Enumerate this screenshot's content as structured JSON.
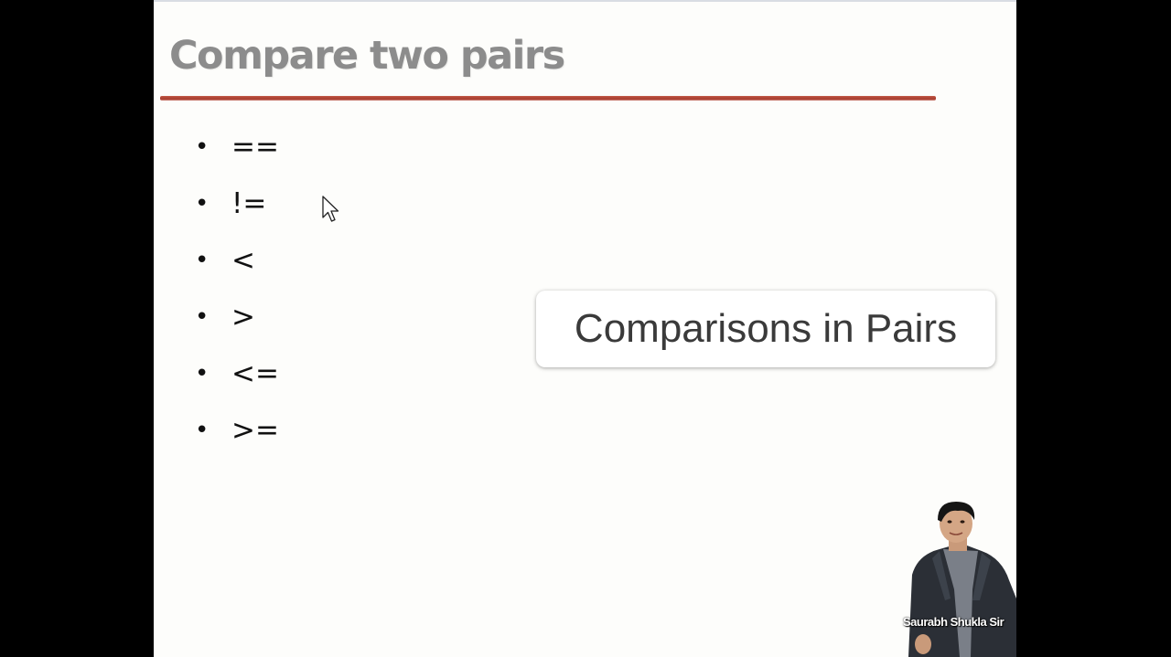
{
  "slide": {
    "title": "Compare two pairs",
    "operators": [
      "==",
      "!=",
      "<",
      ">",
      "<=",
      ">="
    ],
    "bullet_glyph": "•",
    "accent_color": "#b0402f"
  },
  "caption": {
    "text": "Comparisons in Pairs"
  },
  "presenter": {
    "name": "Saurabh Shukla Sir"
  },
  "icons": {
    "cursor": "mouse-pointer-icon"
  }
}
